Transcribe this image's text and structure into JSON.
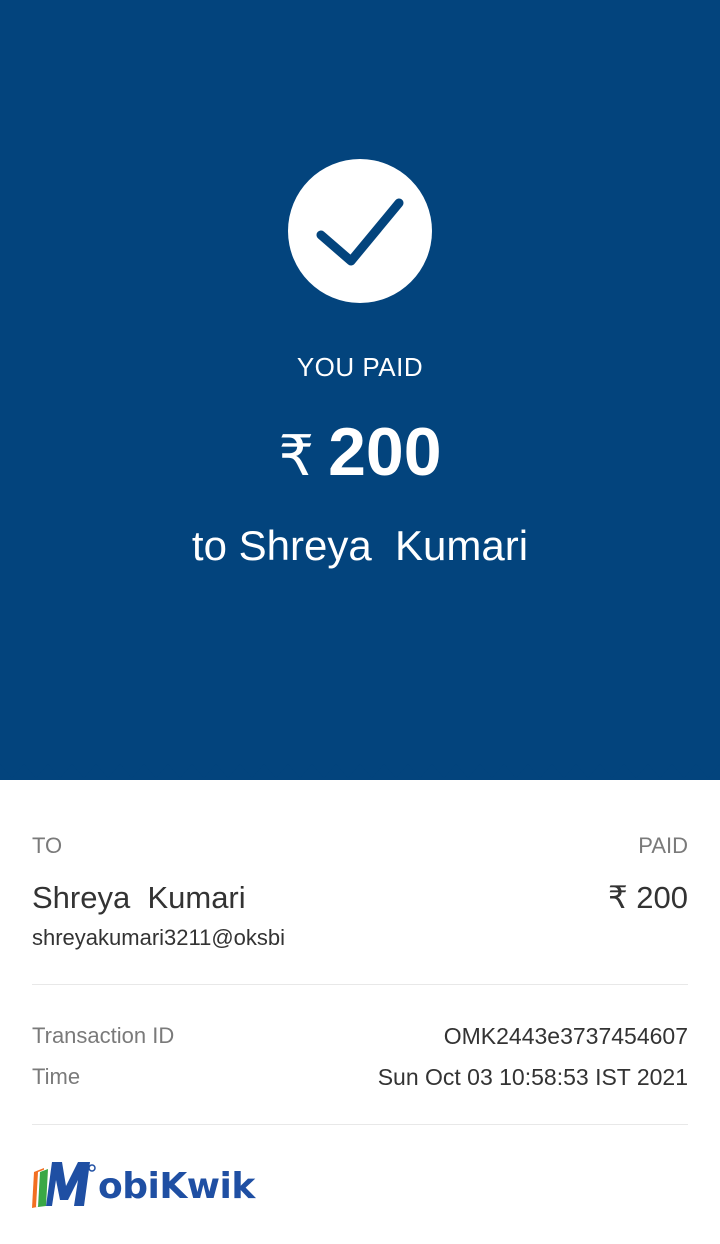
{
  "header": {
    "status_label": "YOU PAID",
    "currency_symbol": "₹",
    "amount": "200",
    "recipient_line": "to Shreya  Kumari",
    "background_color": "#03447d",
    "icon": "checkmark-icon"
  },
  "details": {
    "to_label": "TO",
    "paid_label": "PAID",
    "payee_name": "Shreya  Kumari",
    "payee_vpa": "shreyakumari3211@oksbi",
    "paid_amount": "₹ 200"
  },
  "transaction": {
    "id_label": "Transaction ID",
    "id_value": "OMK2443e3737454607",
    "time_label": "Time",
    "time_value": "Sun Oct 03 10:58:53 IST 2021"
  },
  "brand": {
    "logo_text": "obiKwik",
    "logo_letter": "M",
    "color": "#1f4fa3"
  }
}
